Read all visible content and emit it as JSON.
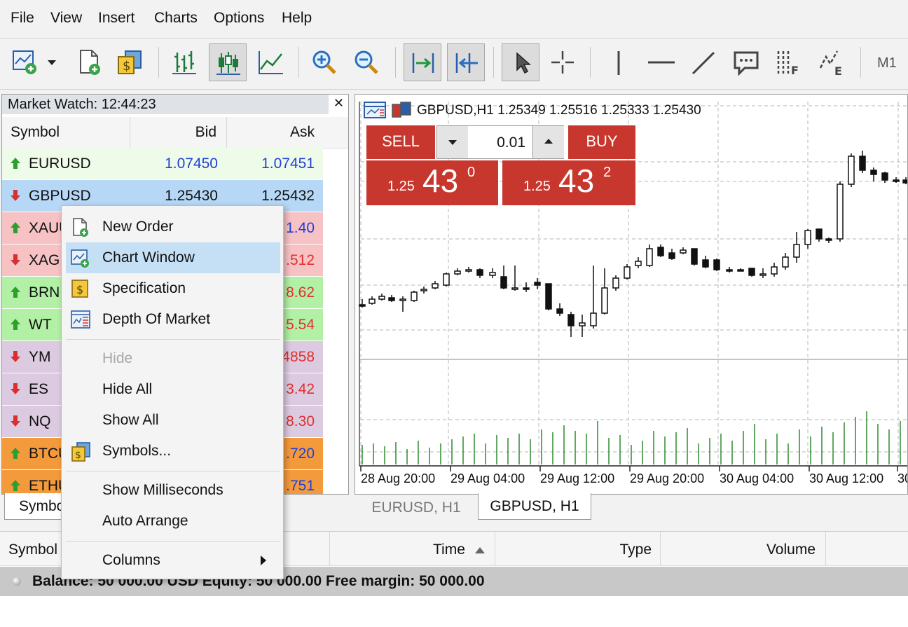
{
  "menu": [
    "File",
    "View",
    "Insert",
    "Charts",
    "Options",
    "Help"
  ],
  "toolbar": {
    "timeframe": "M1"
  },
  "market_watch": {
    "title": "Market Watch: 12:44:23",
    "columns": [
      "Symbol",
      "Bid",
      "Ask"
    ],
    "rows": [
      {
        "symbol": "EURUSD",
        "bid": "1.07450",
        "ask": "1.07451",
        "dir": "up",
        "bg": "#eefbe8",
        "color": "#1f3fd8"
      },
      {
        "symbol": "GBPUSD",
        "bid": "1.25430",
        "ask": "1.25432",
        "dir": "down",
        "bg": "#b6d7f6",
        "color": "#111111"
      },
      {
        "symbol": "XAUUSD",
        "bid": "",
        "ask": "1.40",
        "dir": "up",
        "bg": "#f7c2c4",
        "color": "#1f3fd8"
      },
      {
        "symbol": "XAGUSD",
        "bid": "",
        "ask": ".512",
        "dir": "down",
        "bg": "#f7c2c4",
        "color": "#e03030"
      },
      {
        "symbol": "BRN",
        "bid": "",
        "ask": "8.62",
        "dir": "up",
        "bg": "#b2f0a6",
        "color": "#e03030"
      },
      {
        "symbol": "WT",
        "bid": "",
        "ask": "5.54",
        "dir": "up",
        "bg": "#b2f0a6",
        "color": "#e03030"
      },
      {
        "symbol": "YM",
        "bid": "",
        "ask": "4858",
        "dir": "down",
        "bg": "#dccbe0",
        "color": "#e03030"
      },
      {
        "symbol": "ES",
        "bid": "",
        "ask": "3.42",
        "dir": "down",
        "bg": "#dccbe0",
        "color": "#e03030"
      },
      {
        "symbol": "NQ",
        "bid": "",
        "ask": "8.30",
        "dir": "down",
        "bg": "#dccbe0",
        "color": "#e03030"
      },
      {
        "symbol": "BTCUSD",
        "bid": "",
        "ask": ".720",
        "dir": "up",
        "bg": "#f39a3c",
        "color": "#1f3fd8"
      },
      {
        "symbol": "ETHUSD",
        "bid": "",
        "ask": ".751",
        "dir": "up",
        "bg": "#f39a3c",
        "color": "#1f3fd8"
      }
    ],
    "tab": "Symbols"
  },
  "context_menu": {
    "items": [
      {
        "label": "New Order",
        "icon": "new-order-icon",
        "state": "normal"
      },
      {
        "label": "Chart Window",
        "icon": "chart-window-icon",
        "state": "highlighted"
      },
      {
        "label": "Specification",
        "icon": "specification-icon",
        "state": "normal"
      },
      {
        "label": "Depth Of Market",
        "icon": "depth-of-market-icon",
        "state": "normal"
      },
      {
        "label": "Hide",
        "icon": "",
        "state": "disabled"
      },
      {
        "label": "Hide All",
        "icon": "",
        "state": "normal"
      },
      {
        "label": "Show All",
        "icon": "",
        "state": "normal"
      },
      {
        "label": "Symbols...",
        "icon": "symbols-icon",
        "state": "normal"
      },
      {
        "label": "Show Milliseconds",
        "icon": "",
        "state": "normal"
      },
      {
        "label": "Auto Arrange",
        "icon": "",
        "state": "normal"
      },
      {
        "label": "Columns",
        "icon": "submenu-arrow-icon",
        "state": "normal"
      }
    ]
  },
  "chart": {
    "header": "GBPUSD,H1  1.25349 1.25516 1.25333 1.25430",
    "trade": {
      "sell_label": "SELL",
      "buy_label": "BUY",
      "volume": "0.01",
      "sell_price": {
        "prefix": "1.25",
        "big": "43",
        "sup": "0"
      },
      "buy_price": {
        "prefix": "1.25",
        "big": "43",
        "sup": "2"
      }
    },
    "time_labels": [
      "28 Aug 20:00",
      "29 Aug 04:00",
      "29 Aug 12:00",
      "29 Aug 20:00",
      "30 Aug 04:00",
      "30 Aug 12:00",
      "30"
    ],
    "colors": {
      "grid": "#b5b5b5",
      "volume": "#2e8b2e"
    }
  },
  "chart_tabs": [
    "EURUSD, H1",
    "GBPUSD, H1"
  ],
  "terminal": {
    "columns": [
      "Symbol",
      "Time",
      "Type",
      "Volume"
    ],
    "balance_line": "Balance: 50 000.00 USD  Equity: 50 000.00  Free margin: 50 000.00"
  }
}
